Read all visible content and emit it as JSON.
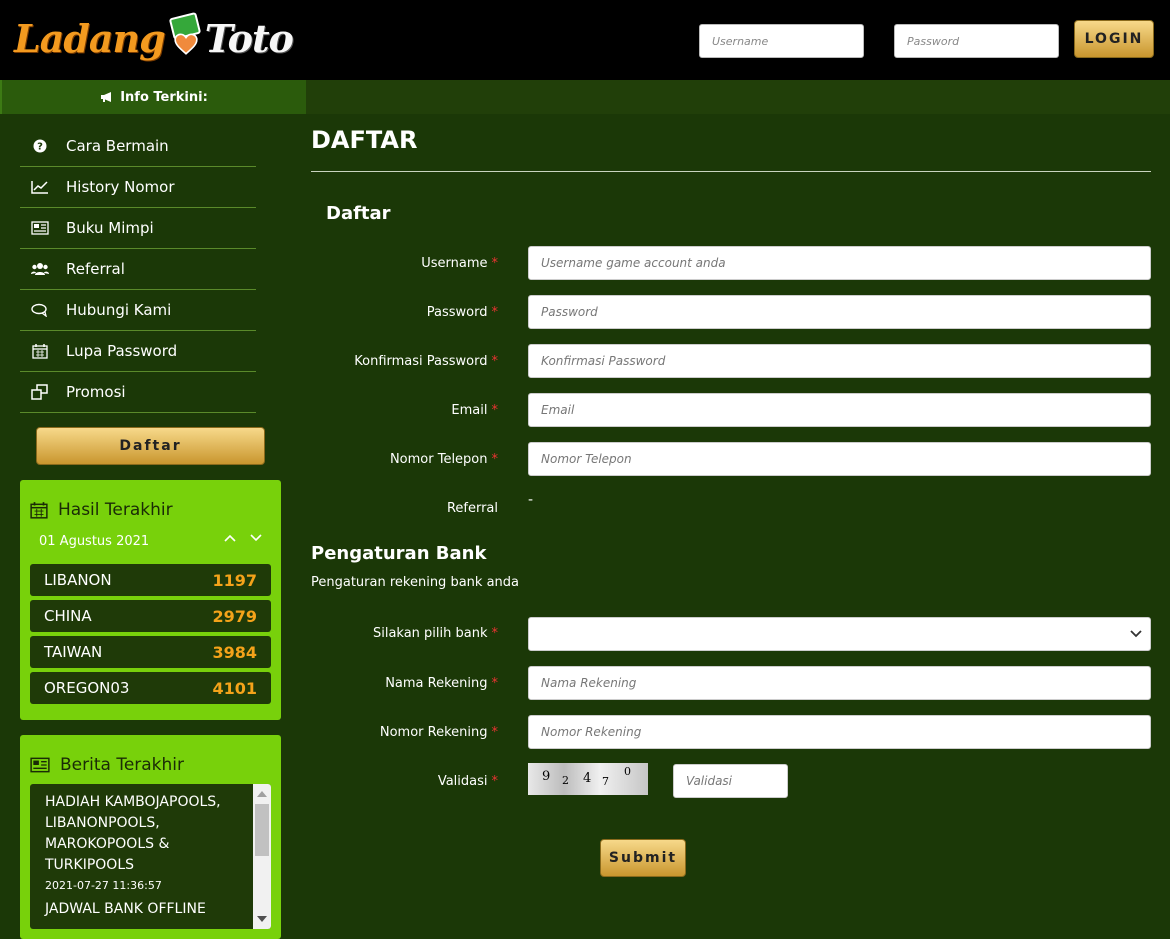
{
  "brand": {
    "logo_left": "Ladang",
    "logo_right": "Toto"
  },
  "header": {
    "username_placeholder": "Username",
    "password_placeholder": "Password",
    "login_label": "LOGIN"
  },
  "sidebar": {
    "info_label": "Info Terkini:",
    "menu": [
      {
        "label": "Cara Bermain",
        "icon": "question-circle-icon"
      },
      {
        "label": "History Nomor",
        "icon": "line-chart-icon"
      },
      {
        "label": "Buku Mimpi",
        "icon": "newspaper-icon"
      },
      {
        "label": "Referral",
        "icon": "users-icon"
      },
      {
        "label": "Hubungi Kami",
        "icon": "chat-icon"
      },
      {
        "label": "Lupa Password",
        "icon": "calendar-icon"
      },
      {
        "label": "Promosi",
        "icon": "windows-icon"
      }
    ],
    "daftar_label": "Daftar",
    "hasil": {
      "title": "Hasil Terakhir",
      "date": "01 Agustus 2021",
      "results": [
        {
          "market": "LIBANON",
          "number": "1197"
        },
        {
          "market": "CHINA",
          "number": "2979"
        },
        {
          "market": "TAIWAN",
          "number": "3984"
        },
        {
          "market": "OREGON03",
          "number": "4101"
        }
      ]
    },
    "berita": {
      "title": "Berita Terakhir",
      "items": [
        {
          "headline": "HADIAH KAMBOJAPOOLS, LIBANONPOOLS, MAROKOPOOLS & TURKIPOOLS",
          "date": "2021-07-27 11:36:57"
        },
        {
          "headline": "JADWAL BANK OFFLINE"
        }
      ]
    }
  },
  "main": {
    "page_title": "DAFTAR",
    "section_title": "Daftar",
    "fields": [
      {
        "label": "Username",
        "placeholder": "Username game account anda"
      },
      {
        "label": "Password",
        "placeholder": "Password"
      },
      {
        "label": "Konfirmasi Password",
        "placeholder": "Konfirmasi Password"
      },
      {
        "label": "Email",
        "placeholder": "Email"
      },
      {
        "label": "Nomor Telepon",
        "placeholder": "Nomor Telepon"
      }
    ],
    "referral_label": "Referral",
    "referral_value": "-",
    "bank_title": "Pengaturan Bank",
    "bank_subtitle": "Pengaturan rekening bank anda",
    "bank_select_label": "Silakan pilih bank",
    "nama_rekening": {
      "label": "Nama Rekening",
      "placeholder": "Nama Rekening"
    },
    "nomor_rekening": {
      "label": "Nomor Rekening",
      "placeholder": "Nomor Rekening"
    },
    "validasi_label": "Validasi",
    "validasi_placeholder": "Validasi",
    "captcha_digits": [
      "9",
      "2",
      "4",
      "7",
      "0"
    ],
    "required_mark": "*",
    "submit_label": "Submit"
  },
  "colors": {
    "accent_gold": "#e2b95a",
    "panel_green": "#78d10b",
    "bg_dark_green": "#1b3807",
    "number_orange": "#f4a31a"
  }
}
